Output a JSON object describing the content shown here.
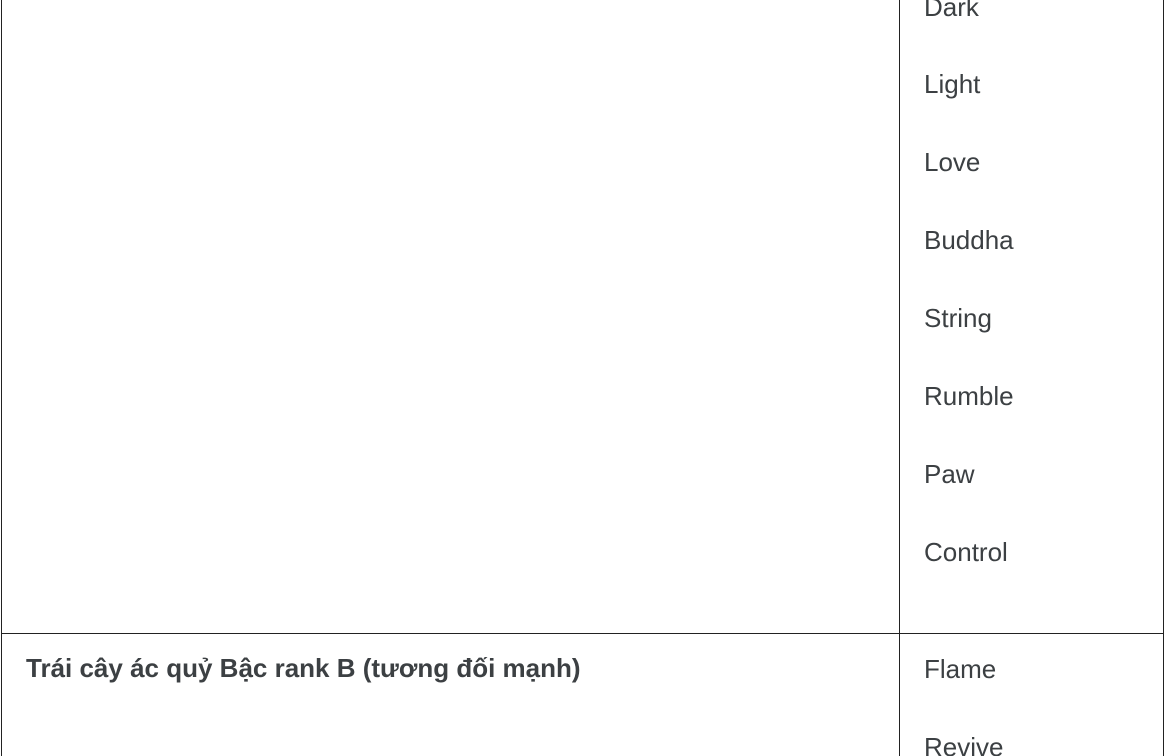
{
  "table": {
    "row1": {
      "left_cell": "",
      "right_items": [
        "Dark",
        "Light",
        "Love",
        "Buddha",
        "String",
        "Rumble",
        "Paw",
        "Control"
      ]
    },
    "row2": {
      "left_cell": "Trái cây ác quỷ  Bậc rank B (tương đối mạnh)",
      "right_items": [
        "Flame",
        "Revive"
      ]
    }
  }
}
